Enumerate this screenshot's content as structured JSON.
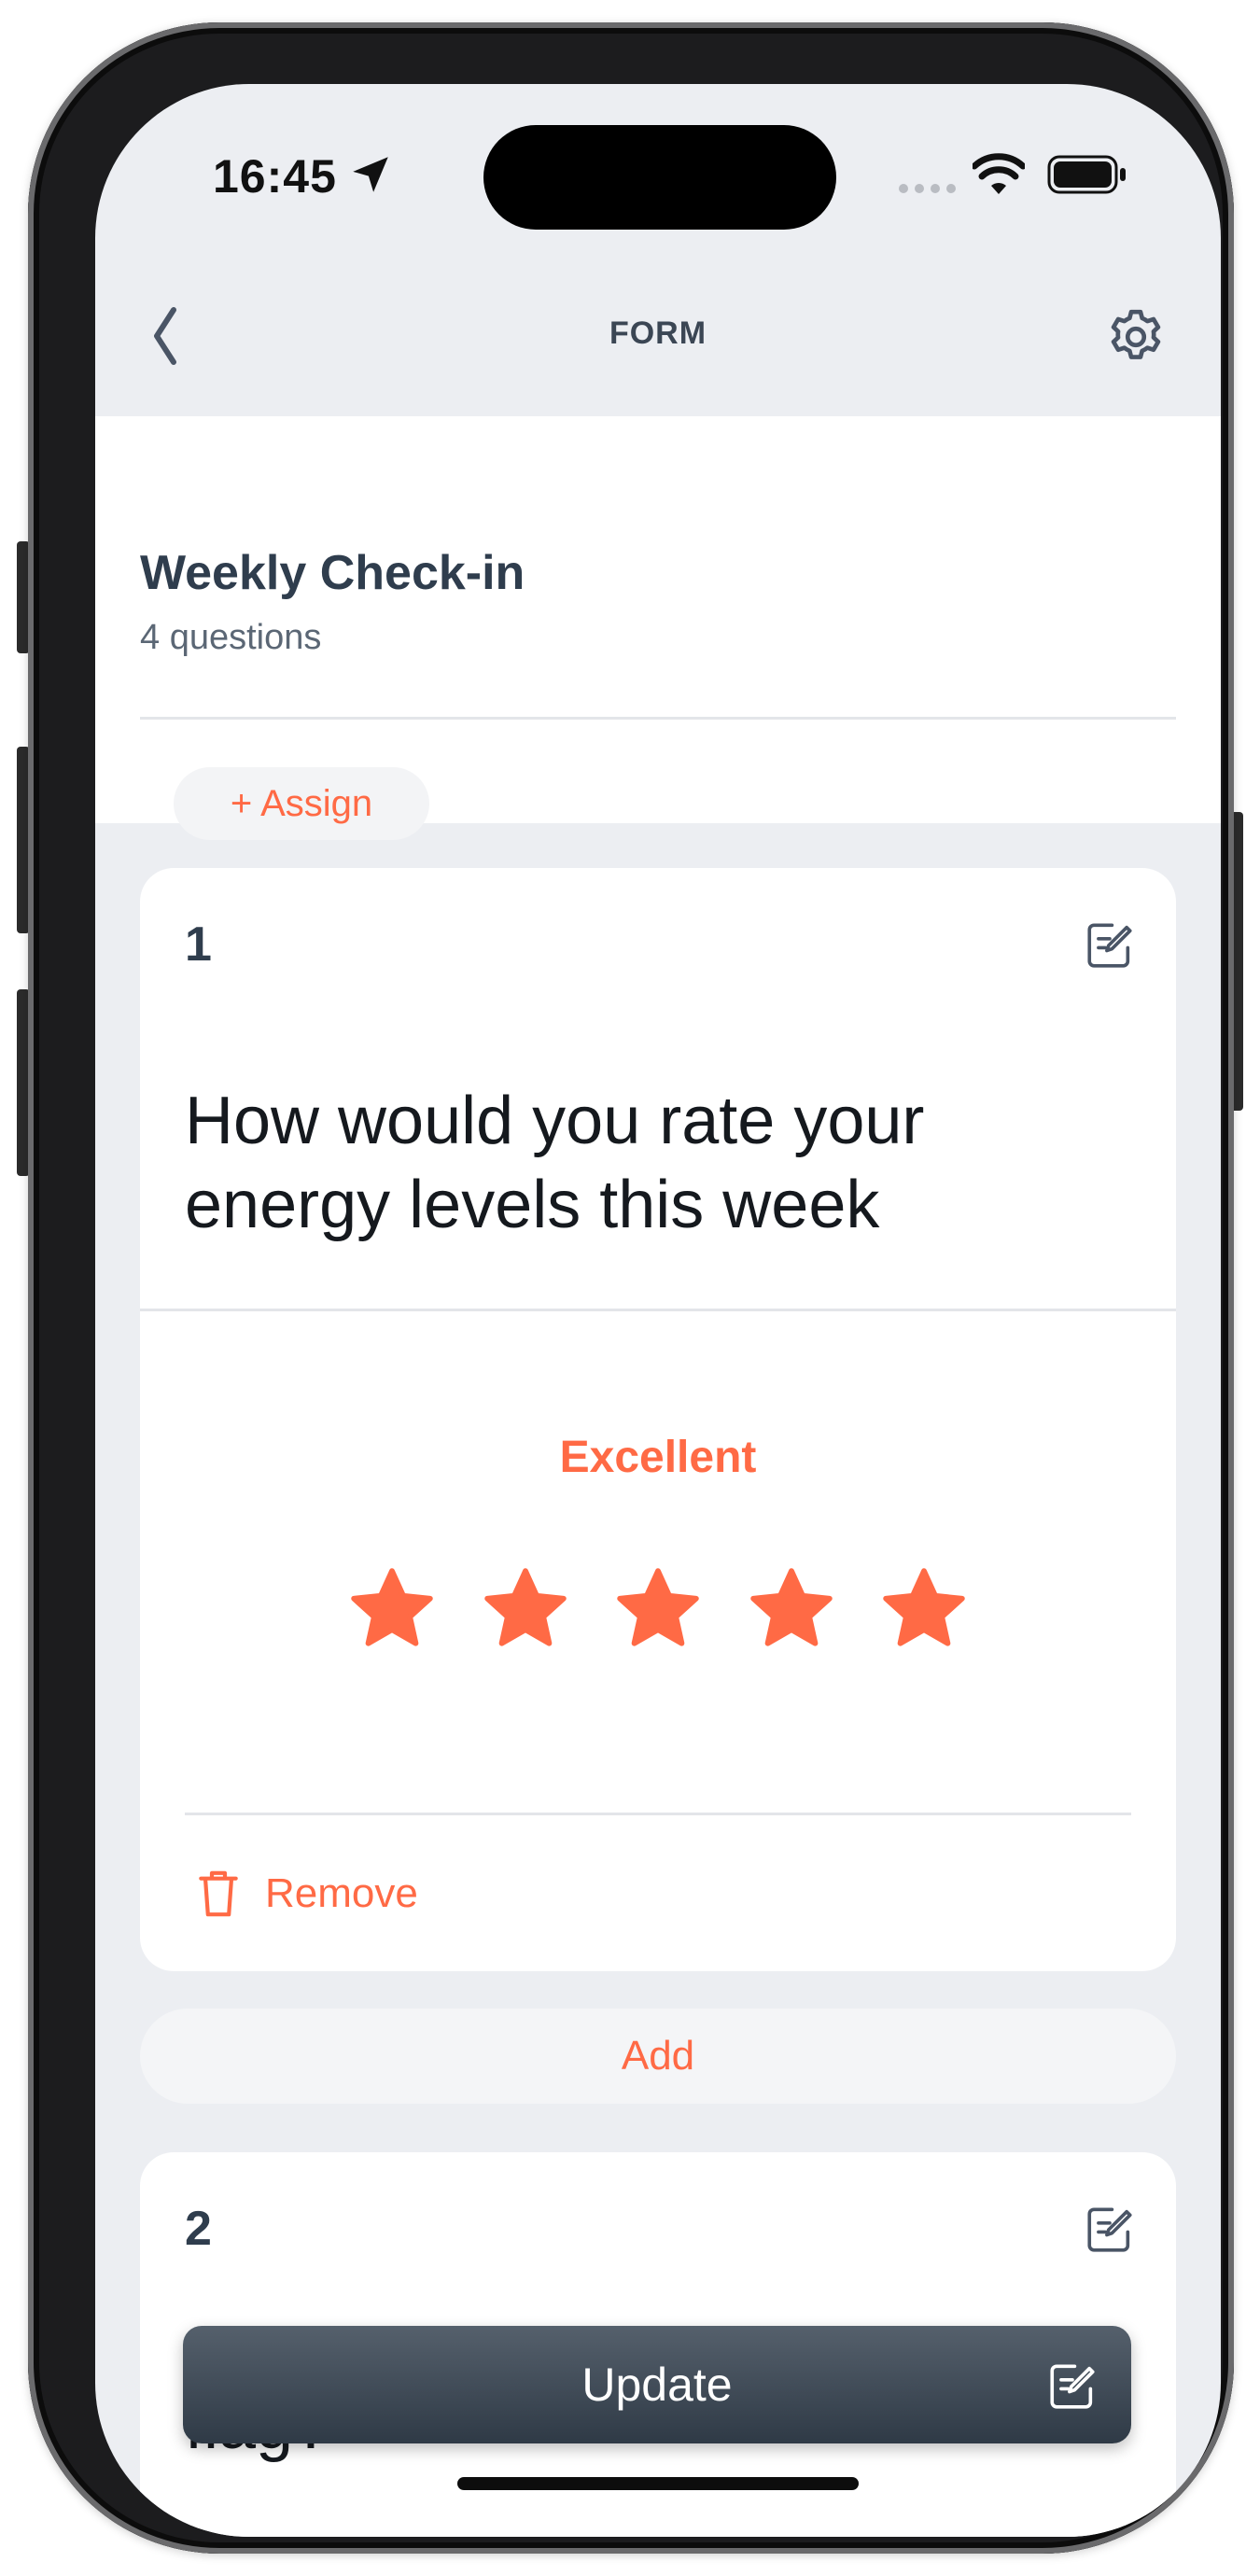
{
  "status_bar": {
    "time": "16:45",
    "icons": [
      "location-arrow-icon",
      "cellular-signal-icon",
      "wifi-icon",
      "battery-icon"
    ]
  },
  "nav": {
    "back_icon": "chevron-left-icon",
    "title": "FORM",
    "settings_icon": "gear-icon"
  },
  "form": {
    "title": "Weekly Check-in",
    "subtitle": "4 questions",
    "assign_label": "+ Assign"
  },
  "questions": [
    {
      "number": "1",
      "text": "How would you rate your energy levels this week",
      "rating_label": "Excellent",
      "rating": 5,
      "rating_max": 5,
      "remove_label": "Remove"
    },
    {
      "number": "2",
      "text": "flag?"
    }
  ],
  "add_label": "Add",
  "update_label": "Update",
  "colors": {
    "accent": "#ff6a45",
    "text_dark": "#2f3d4d",
    "background": "#eceef2",
    "update_button": "#3b4654"
  }
}
